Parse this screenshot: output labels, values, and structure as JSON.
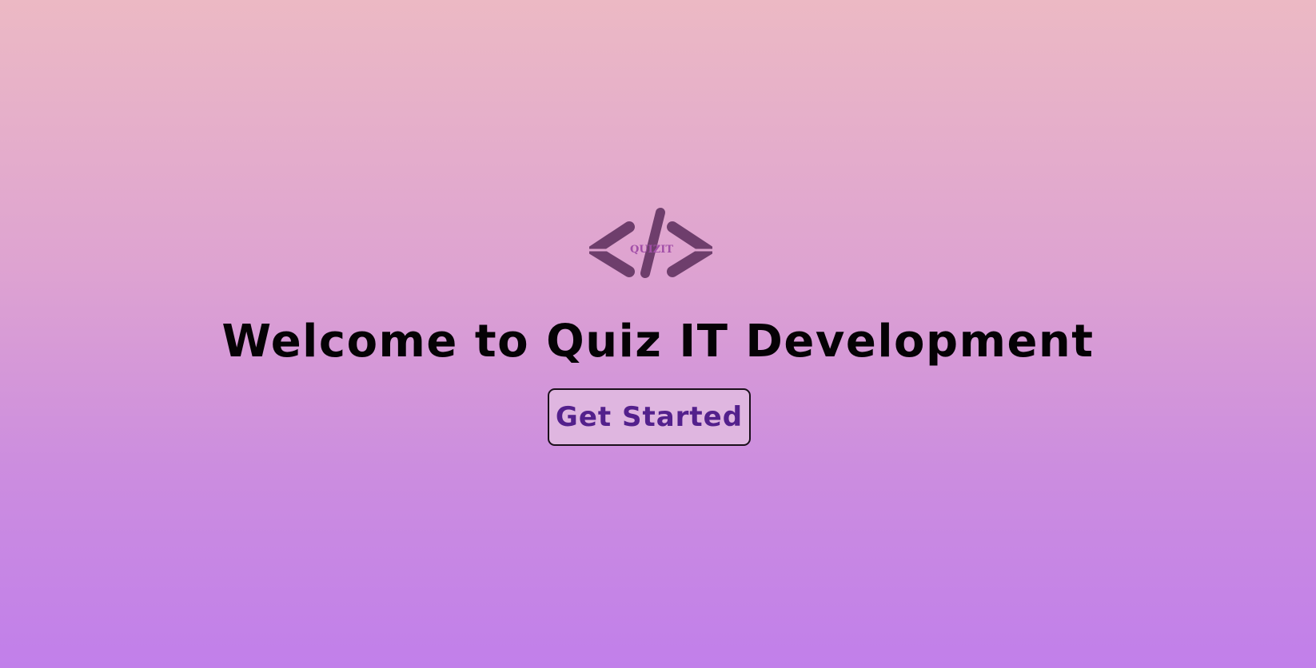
{
  "logo": {
    "icon": "code-slash-icon",
    "text": "QUIZIT",
    "color": "#6e3e6c",
    "text_color": "#a24fa8"
  },
  "hero": {
    "title": "Welcome to Quiz IT Development"
  },
  "cta": {
    "label": "Get Started"
  },
  "colors": {
    "background_top": "#ecb9c4",
    "background_bottom": "#c17fea",
    "button_bg": "#dfb6e0",
    "button_text": "#53208c",
    "title_text": "#050205"
  }
}
